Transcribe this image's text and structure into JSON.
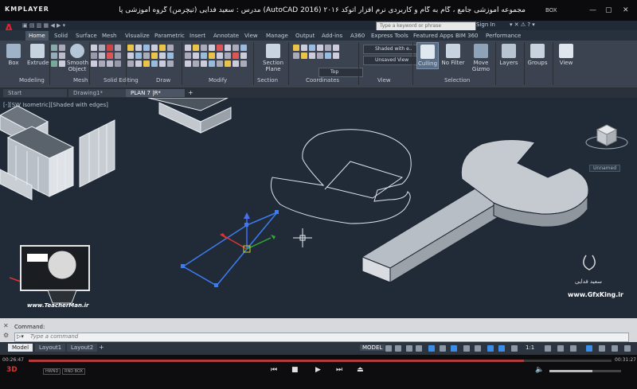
{
  "player": {
    "logo": "KMPLAYER",
    "title": "مجموعه آموزشی جامع ، گام به گام و کاربردی نرم افزار اتوکد ۲۰۱۶ (AutoCAD 2016) مدرس : سعید فدایی (تیچرمن) گروه آموزشی پادشاه گرافیست ها",
    "box_label": "BOX",
    "time_current": "00:26:47",
    "time_total": "00:31:27",
    "progress": 0.85,
    "volume": 0.6,
    "tags": [
      "HWND",
      "RND BOX"
    ]
  },
  "acad": {
    "search_placeholder": "Type a keyword or phrase",
    "signin": "Sign In",
    "ribbon_tabs": [
      "Home",
      "Solid",
      "Surface",
      "Mesh",
      "Visualize",
      "Parametric",
      "Insert",
      "Annotate",
      "View",
      "Manage",
      "Output",
      "Add-ins",
      "A360",
      "Express Tools",
      "Featured Apps",
      "BIM 360",
      "Performance"
    ],
    "buttons": {
      "box": "Box",
      "extrude": "Extrude",
      "smooth_object": "Smooth Object",
      "section_plane": "Section Plane",
      "culling": "Culling",
      "no_filter": "No Filter",
      "move_gizmo": "Move Gizmo",
      "layers": "Layers",
      "groups": "Groups",
      "view": "View"
    },
    "panels": [
      "Modeling",
      "Mesh",
      "Solid Editing",
      "Draw",
      "Modify",
      "Section",
      "Coordinates",
      "View",
      "Selection"
    ],
    "dropdowns": {
      "visual_style": "Shaded with e...",
      "view_state": "Unsaved View",
      "ucs": "Top"
    },
    "file_tabs": [
      "Start",
      "Drawing1*",
      "PLAN 7 |R*"
    ],
    "viewport_label": "[-][SW Isometric][Shaded with edges]",
    "viewcube_label": "Unnamed",
    "command_label": "Command:",
    "command_placeholder": "Type a command",
    "layout_tabs": [
      "Model",
      "Layout1",
      "Layout2"
    ],
    "model_button": "MODEL",
    "scale": "1:1"
  },
  "watermarks": {
    "teacher_url": "www.TeacherMan.ir",
    "gfx_url": "www.GfxKing.ir",
    "fa_name": "سعید فدایی"
  },
  "colors": {
    "viewport_bg": "#212b38",
    "selected_edge": "#3c7cf0",
    "autocad_red": "#d9262c"
  }
}
